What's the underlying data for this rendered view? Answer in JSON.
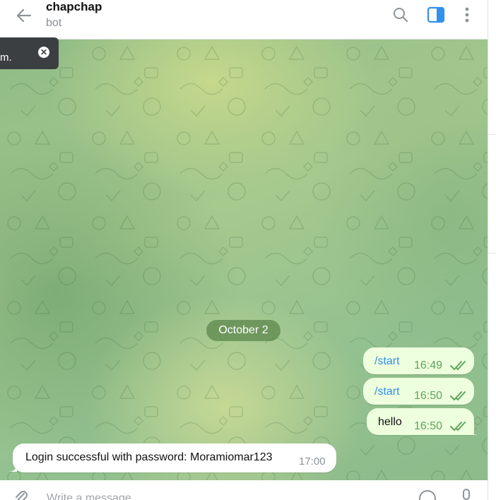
{
  "header": {
    "title": "chapchap",
    "subtitle": "bot",
    "icons": [
      "back-arrow-icon",
      "search-icon",
      "sidebar-toggle-icon",
      "more-vertical-icon"
    ],
    "accent": "#3390ec"
  },
  "toast": {
    "text": "m."
  },
  "chat": {
    "date_chip": "October 2",
    "outgoing": [
      {
        "text": "/start",
        "time": "16:49",
        "is_command": true
      },
      {
        "text": "/start",
        "time": "16:50",
        "is_command": true
      },
      {
        "text": "hello",
        "time": "16:50",
        "is_command": false
      }
    ],
    "incoming": [
      {
        "text": "Login successful with password: Moramiomar123",
        "time": "17:00"
      }
    ],
    "colors": {
      "outgoing_bg": "#eeffde",
      "time_green": "#5fa35c",
      "command_blue": "#3390ec"
    }
  },
  "composer": {
    "placeholder": "Write a message..."
  }
}
